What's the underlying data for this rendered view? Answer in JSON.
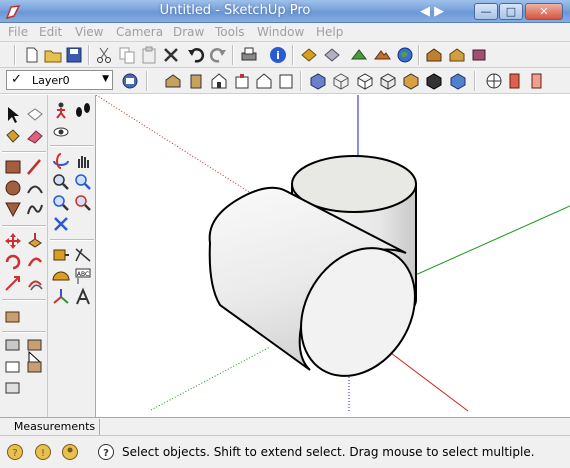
{
  "window": {
    "title": "Untitled - SketchUp Pro",
    "nav_arrows": "◀ ▶",
    "minimize_label": "—",
    "maximize_label": "□",
    "close_label": "✕"
  },
  "menu": {
    "items": [
      "File",
      "Edit",
      "View",
      "Camera",
      "Draw",
      "Tools",
      "Window",
      "Help"
    ]
  },
  "layer": {
    "check": "✓",
    "name": "Layer0",
    "arrow": "▼"
  },
  "measurements": {
    "label": "Measurements"
  },
  "status": {
    "text": "Select objects. Shift to extend select. Drag mouse to select multiple."
  },
  "colors": {
    "title_bar": "#7aa3dc",
    "red_axis": "#d32020",
    "green_axis": "#1a9a1a",
    "blue_axis": "#1a1ad0",
    "cylinder_face": "#f2f2f2"
  }
}
